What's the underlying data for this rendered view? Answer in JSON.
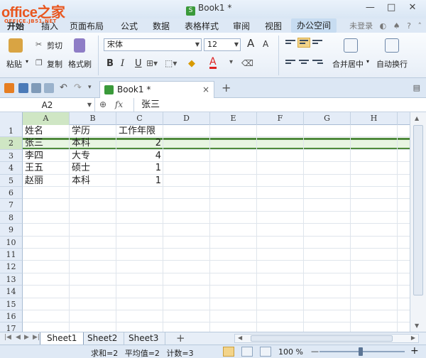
{
  "window": {
    "logo": "office之家",
    "logo_sub": "OFFICE.JB51.NET",
    "title": "Book1 *",
    "minimize": "—",
    "restore": "□",
    "close": "✕"
  },
  "menu": {
    "tabs": [
      "开始",
      "插入",
      "页面布局",
      "公式",
      "数据",
      "表格样式",
      "审阅",
      "视图",
      "办公空间"
    ],
    "login": "未登录"
  },
  "ribbon": {
    "paste": "粘贴",
    "cut": "剪切",
    "copy": "复制",
    "format_painter": "格式刷",
    "font_name": "宋体",
    "font_size": "12",
    "bold": "B",
    "italic": "I",
    "underline": "U",
    "grow": "A",
    "shrink": "A",
    "merge_center": "合并居中",
    "wrap_text": "自动换行"
  },
  "docbar": {
    "tab_title": "Book1 *",
    "close": "×",
    "new_tab": "+"
  },
  "formula_bar": {
    "name_box": "A2",
    "fx_label": "fx",
    "content": "张三"
  },
  "grid": {
    "columns": [
      "A",
      "B",
      "C",
      "D",
      "E",
      "F",
      "G",
      "H"
    ],
    "rows": [
      "1",
      "2",
      "3",
      "4",
      "5",
      "6",
      "7",
      "8",
      "9",
      "10",
      "11",
      "12",
      "13",
      "14",
      "15",
      "16",
      "17"
    ],
    "cells": [
      [
        "姓名",
        "学历",
        "工作年限"
      ],
      [
        "张三",
        "本科",
        "2"
      ],
      [
        "李四",
        "大专",
        "4"
      ],
      [
        "王五",
        "硕士",
        "1"
      ],
      [
        "赵丽",
        "本科",
        "1"
      ]
    ]
  },
  "sheets": {
    "tabs": [
      "Sheet1",
      "Sheet2",
      "Sheet3"
    ],
    "add": "+"
  },
  "status": {
    "sum": "求和=2",
    "avg": "平均值=2",
    "count": "计数=3",
    "zoom": "100 %",
    "zoom_out": "—",
    "zoom_in": "+"
  },
  "colors": {
    "selection_border": "#4f8a3c",
    "selection_fill": "#e8f5e2",
    "logo": "#e9561e"
  }
}
